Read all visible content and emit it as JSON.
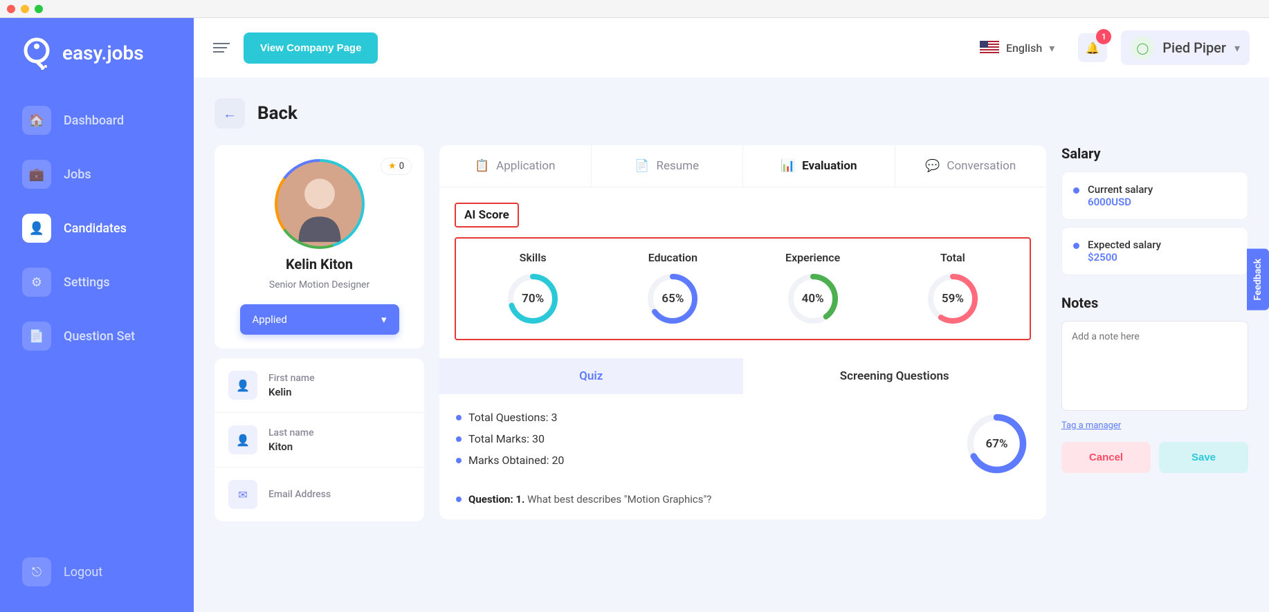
{
  "brand": "easy.jobs",
  "header": {
    "view_company": "View Company Page",
    "language": "English",
    "notifications": "1",
    "company": "Pied Piper"
  },
  "sidebar": {
    "items": [
      {
        "label": "Dashboard"
      },
      {
        "label": "Jobs"
      },
      {
        "label": "Candidates"
      },
      {
        "label": "Settings"
      },
      {
        "label": "Question Set"
      }
    ],
    "logout": "Logout"
  },
  "page": {
    "back": "Back"
  },
  "candidate": {
    "name": "Kelin Kiton",
    "title": "Senior Motion Designer",
    "status": "Applied",
    "star_count": "0",
    "fields": {
      "first_name_label": "First name",
      "first_name": "Kelin",
      "last_name_label": "Last name",
      "last_name": "Kiton",
      "email_label": "Email Address"
    }
  },
  "tabs": {
    "application": "Application",
    "resume": "Resume",
    "evaluation": "Evaluation",
    "conversation": "Conversation"
  },
  "ai": {
    "title": "AI Score",
    "metrics": [
      {
        "label": "Skills",
        "value": 70,
        "txt": "70%",
        "color": "#2bc9d7"
      },
      {
        "label": "Education",
        "value": 65,
        "txt": "65%",
        "color": "#5e7bff"
      },
      {
        "label": "Experience",
        "value": 40,
        "txt": "40%",
        "color": "#4caf50"
      },
      {
        "label": "Total",
        "value": 59,
        "txt": "59%",
        "color": "#ff6b7d"
      }
    ]
  },
  "subtabs": {
    "quiz": "Quiz",
    "screening": "Screening Questions"
  },
  "quiz": {
    "total_q": "Total Questions: 3",
    "total_m": "Total Marks: 30",
    "obtained": "Marks Obtained: 20",
    "score": 67,
    "score_txt": "67%",
    "question_label": "Question: 1.",
    "question_text": "What best describes \"Motion Graphics\"?"
  },
  "salary": {
    "title": "Salary",
    "current_label": "Current salary",
    "current_value": "6000USD",
    "expected_label": "Expected salary",
    "expected_value": "$2500"
  },
  "notes": {
    "title": "Notes",
    "placeholder": "Add a note here",
    "tag_link": "Tag a manager",
    "cancel": "Cancel",
    "save": "Save"
  },
  "feedback": "Feedback"
}
